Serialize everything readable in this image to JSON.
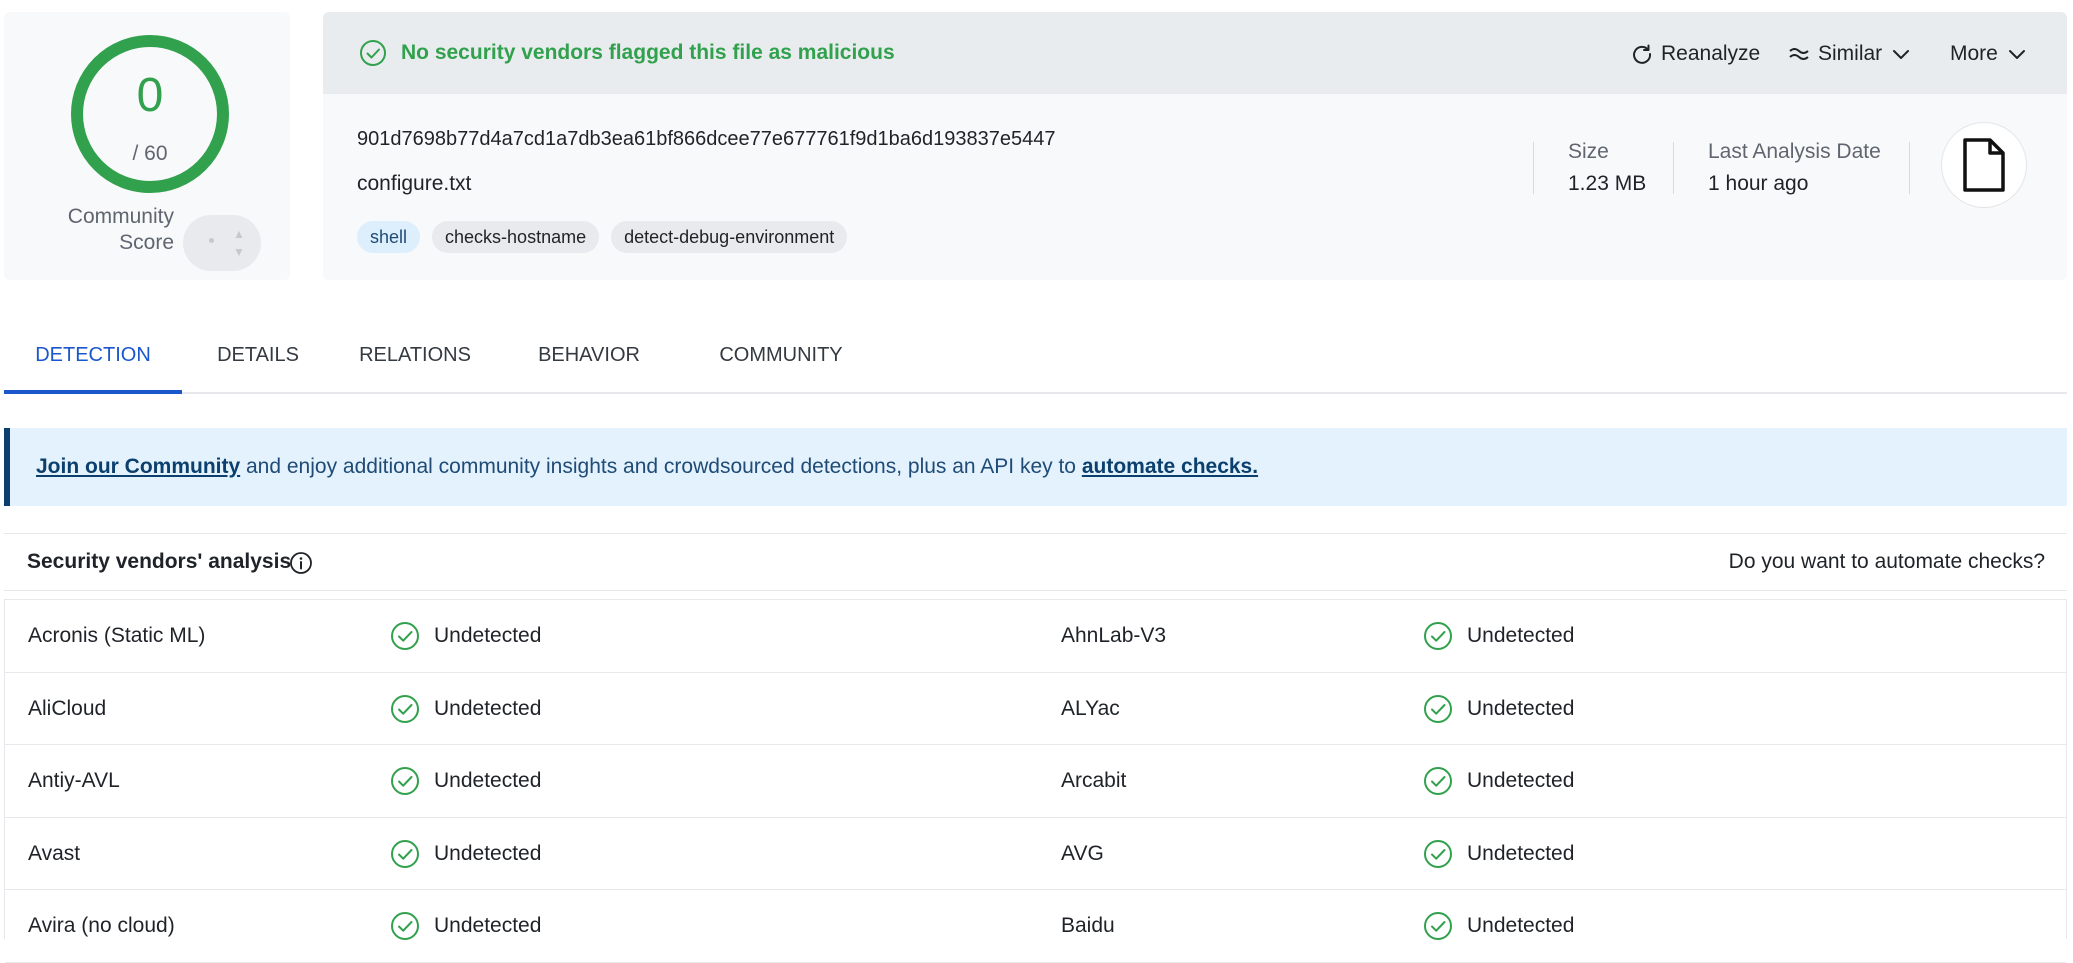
{
  "score": {
    "detected": "0",
    "total_label": "/ 60",
    "community_label_line1": "Community",
    "community_label_line2": "Score",
    "ring_color": "#31a14d"
  },
  "verdict": {
    "text": "No security vendors flagged this file as malicious",
    "color": "#31a14d",
    "icon": "check-circle-icon"
  },
  "actions": {
    "reanalyze": "Reanalyze",
    "similar": "Similar",
    "more": "More"
  },
  "file": {
    "hash": "901d7698b77d4a7cd1a7db3ea61bf866dcee77e677761f9d1ba6d193837e5447",
    "name": "configure.txt",
    "tags": [
      "shell",
      "checks-hostname",
      "detect-debug-environment"
    ],
    "size_label": "Size",
    "size_value": "1.23 MB",
    "date_label": "Last Analysis Date",
    "date_value": "1 hour ago",
    "type_icon": "file-icon"
  },
  "tabs": [
    "DETECTION",
    "DETAILS",
    "RELATIONS",
    "BEHAVIOR",
    "COMMUNITY"
  ],
  "banner": {
    "link1": "Join our Community",
    "middle": " and enjoy additional community insights and crowdsourced detections, plus an API key to ",
    "link2": "automate checks."
  },
  "vendors": {
    "title": "Security vendors' analysis",
    "cta": "Do you want to automate checks?",
    "rows": [
      [
        {
          "name": "Acronis (Static ML)",
          "result": "Undetected"
        },
        {
          "name": "AhnLab-V3",
          "result": "Undetected"
        }
      ],
      [
        {
          "name": "AliCloud",
          "result": "Undetected"
        },
        {
          "name": "ALYac",
          "result": "Undetected"
        }
      ],
      [
        {
          "name": "Antiy-AVL",
          "result": "Undetected"
        },
        {
          "name": "Arcabit",
          "result": "Undetected"
        }
      ],
      [
        {
          "name": "Avast",
          "result": "Undetected"
        },
        {
          "name": "AVG",
          "result": "Undetected"
        }
      ],
      [
        {
          "name": "Avira (no cloud)",
          "result": "Undetected"
        },
        {
          "name": "Baidu",
          "result": "Undetected"
        }
      ]
    ]
  }
}
